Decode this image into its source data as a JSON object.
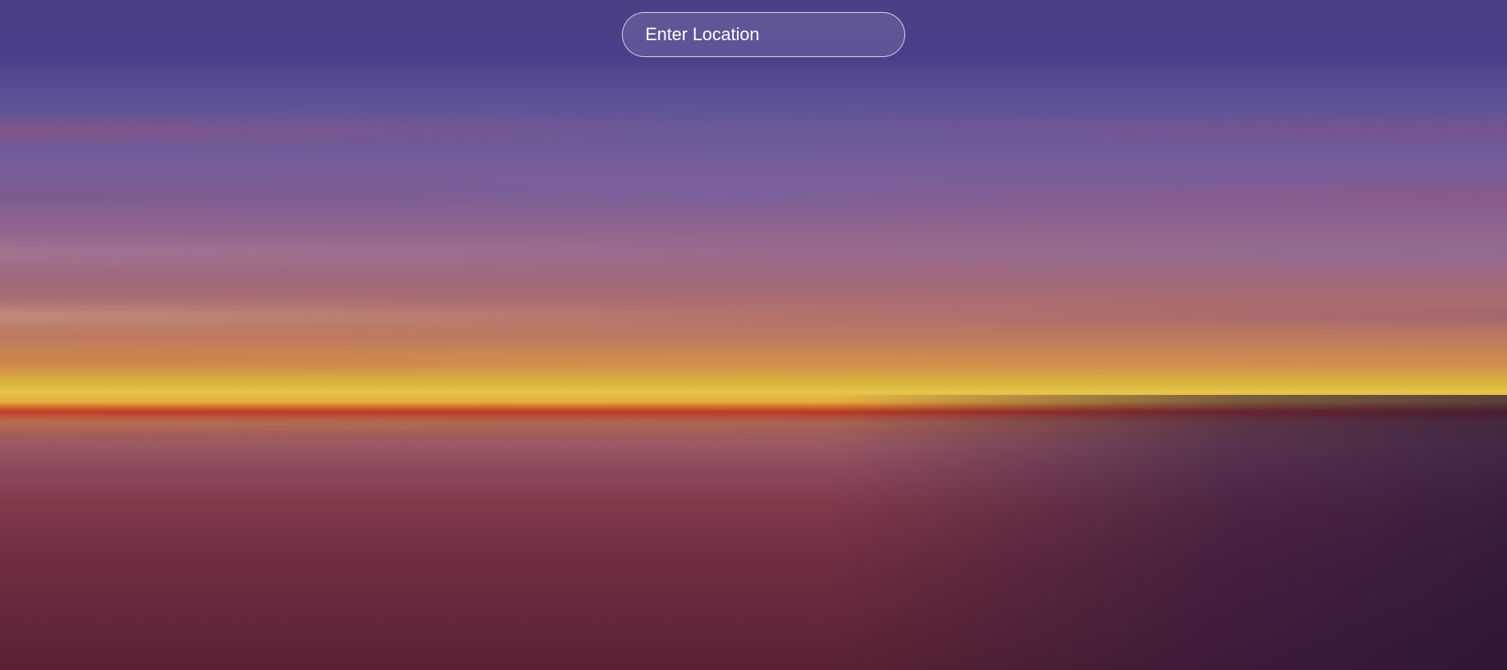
{
  "search": {
    "placeholder": "Enter Location",
    "value": ""
  },
  "background": {
    "description_colors": {
      "sky_top": "#4d3f86",
      "horizon_glow": "#e6c54a",
      "horizon_red": "#b8301c",
      "sand": "#6f2d40"
    }
  }
}
